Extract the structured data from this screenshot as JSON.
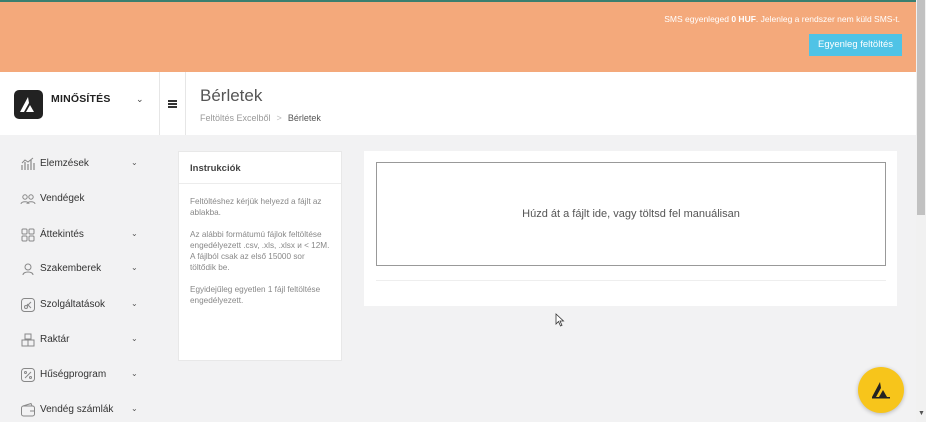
{
  "banner": {
    "text_prefix": "SMS egyenleged ",
    "balance": "0 HUF",
    "text_suffix": ". Jelenleg a rendszer nem küld SMS-t.",
    "button_label": "Egyenleg feltöltés",
    "colors": {
      "background": "#f4a97b",
      "button": "#4fc3e6"
    }
  },
  "brand": {
    "name": "MINŐSÍTÉS",
    "icon": "logo-triangle-icon"
  },
  "header": {
    "title": "Bérletek",
    "breadcrumb": [
      "Feltöltés Excelből",
      "Bérletek"
    ],
    "breadcrumb_separator": ">"
  },
  "sidebar": {
    "items": [
      {
        "label": "Elemzések",
        "icon": "chart-icon",
        "has_submenu": true
      },
      {
        "label": "Vendégek",
        "icon": "users-icon",
        "has_submenu": false
      },
      {
        "label": "Áttekintés",
        "icon": "grid-icon",
        "has_submenu": true
      },
      {
        "label": "Szakemberek",
        "icon": "user-icon",
        "has_submenu": true
      },
      {
        "label": "Szolgáltatások",
        "icon": "scissors-icon",
        "has_submenu": true
      },
      {
        "label": "Raktár",
        "icon": "boxes-icon",
        "has_submenu": true
      },
      {
        "label": "Hűségprogram",
        "icon": "percent-icon",
        "has_submenu": true
      },
      {
        "label": "Vendég számlák",
        "icon": "wallet-icon",
        "has_submenu": true
      }
    ]
  },
  "instructions": {
    "title": "Instrukciók",
    "p1": "Feltöltéshez kérjük helyezd a fájlt az ablakba.",
    "p2a": "Az alábbi formátumú fájlok feltöltése engedélyezett .csv, .xls, .xlsx и < 12M.",
    "p2b": "A fájlból csak az első 15000 sor töltődik be.",
    "p3": "Egyidejűleg egyetlen 1 fájl feltöltése engedélyezett."
  },
  "upload": {
    "dropzone_text": "Húzd át a fájlt ide, vagy töltsd fel manuálisan"
  },
  "fab": {
    "icon": "logo-triangle-icon",
    "color": "#f7c51b"
  }
}
